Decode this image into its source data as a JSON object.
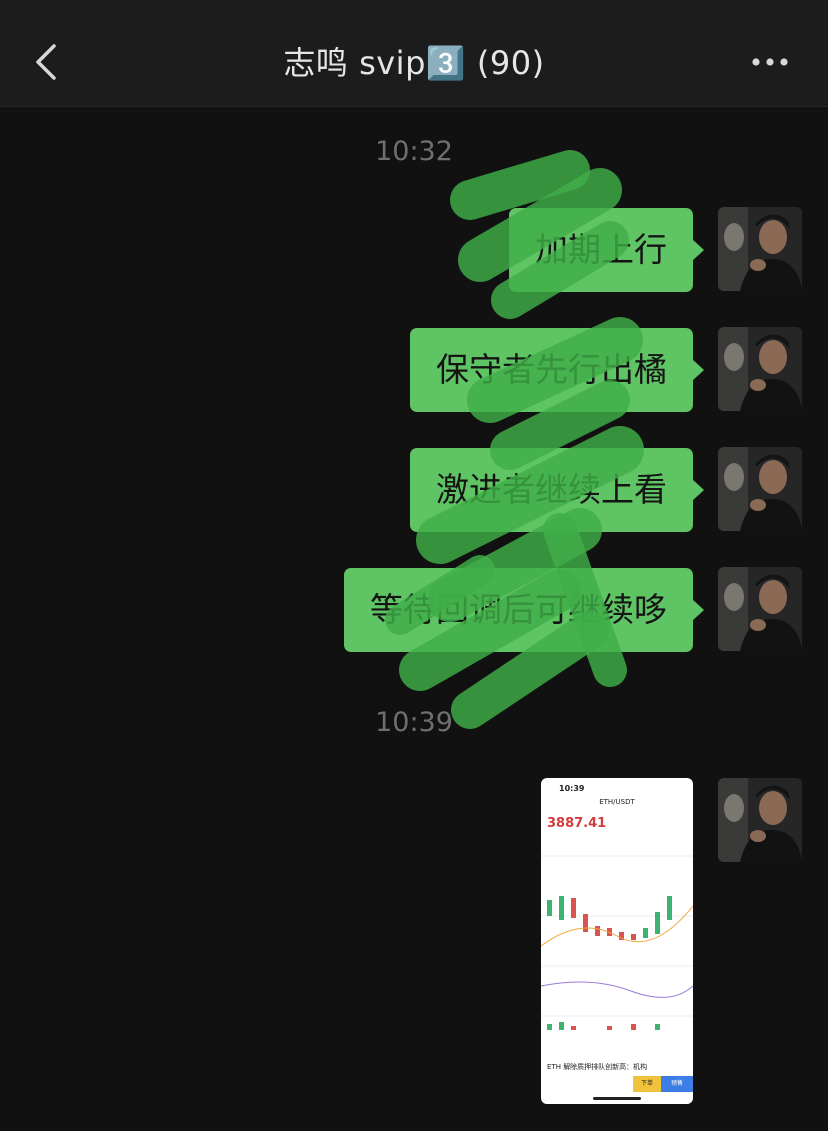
{
  "header": {
    "title": "志鸣 svip3️⃣ (90)"
  },
  "chat": {
    "time_1": "10:32",
    "time_2": "10:39",
    "messages": [
      {
        "text": "加期上行"
      },
      {
        "text": "保守者先行出橘"
      },
      {
        "text": "激进者继续上看"
      },
      {
        "text": "等待回调后可继续哆"
      }
    ],
    "image_message": {
      "status_time": "10:39",
      "pair": "ETH/USDT",
      "price": "3887.41",
      "news": "ETH 解除质押排队创新高：机构",
      "sell_label": "下单",
      "buy_label": "预售"
    }
  },
  "colors": {
    "bubble": "#5fc463",
    "background": "#111111",
    "navbar": "#1c1c1c"
  }
}
